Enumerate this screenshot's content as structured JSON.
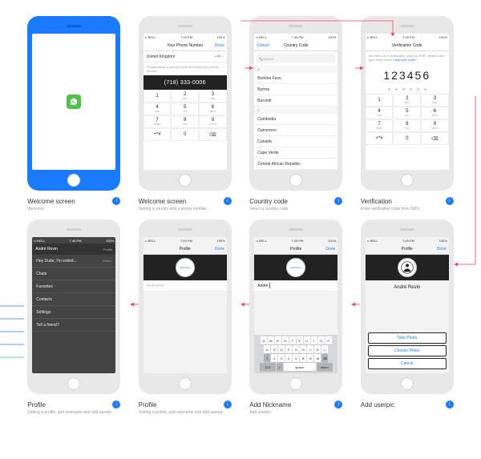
{
  "status": {
    "carrier": "•• BELL",
    "wifi": "⚲",
    "time": "7:45 PM",
    "batt": "100%"
  },
  "screens": [
    {
      "title": "Welcome screen",
      "sub": "Welcome"
    },
    {
      "title": "Welcome screen",
      "sub": "Setting a country and a phone number",
      "nav": {
        "title": "Your Phone Number",
        "right": "Done"
      },
      "country": "United Kingdom",
      "cc": "+44",
      "phone": "(718) 333-0006",
      "help": "Please select a country code and enter your phone number"
    },
    {
      "title": "Country code",
      "sub": "Select a country code",
      "nav": {
        "left": "Cancel",
        "title": "Country Code"
      },
      "search": "Search",
      "groups": [
        {
          "h": "B",
          "items": [
            "Burkina Faso",
            "Burma",
            "Burundi"
          ]
        },
        {
          "h": "C",
          "items": [
            "Cambodia",
            "Cameroon",
            "Canada",
            "Cape Verde",
            "Central African Republic"
          ]
        }
      ]
    },
    {
      "title": "Verification",
      "sub": "Enter verification code from SMS",
      "nav": {
        "title": "Verification Code"
      },
      "help": "We sent you a verification code by SMS, please enter your code below.",
      "helplink": "Help with code?",
      "code": "123456"
    },
    {
      "title": "Profile",
      "sub": "Setting a profile, add nickname and add userpic",
      "nav": {
        "name": "André Revin",
        "right": "Profile"
      },
      "status": {
        "text": "Hey Dude, I'm exited...",
        "sub": "Status"
      },
      "menu": [
        "Chats",
        "Favorites",
        "Contacts",
        "Settings",
        "Tell a friend?"
      ]
    },
    {
      "title": "Profile",
      "sub": "Setting a profile, add nickname and add userpic",
      "nav": {
        "title": "Profile",
        "right": "Done"
      },
      "avatar": "Add Photo",
      "nick_placeholder": "Nickname"
    },
    {
      "title": "Add Nickname",
      "sub": "Add userpic",
      "nav": {
        "title": "Profile",
        "right": "Done"
      },
      "avatar": "Add Photo",
      "nick_value": "Andre"
    },
    {
      "title": "Add userpic",
      "sub": "",
      "nav": {
        "title": "Profile",
        "right": "Done"
      },
      "name": "André Revin",
      "sheet": [
        "Take Photo",
        "Choose Photo",
        "Cancel"
      ]
    }
  ],
  "keypad": [
    [
      "1",
      ""
    ],
    [
      "2",
      "ABC"
    ],
    [
      "3",
      "DEF"
    ],
    [
      "4",
      "GHI"
    ],
    [
      "5",
      "JKL"
    ],
    [
      "6",
      "MNO"
    ],
    [
      "7",
      "PQRS"
    ],
    [
      "8",
      "TUV"
    ],
    [
      "9",
      "WXYZ"
    ],
    [
      "+*#",
      ""
    ],
    [
      "0",
      ""
    ],
    [
      "⌫",
      ""
    ]
  ],
  "qwerty": {
    "r1": [
      "Q",
      "W",
      "E",
      "R",
      "T",
      "Y",
      "U",
      "I",
      "O",
      "P"
    ],
    "r2": [
      "A",
      "S",
      "D",
      "F",
      "G",
      "H",
      "J",
      "K",
      "L"
    ],
    "r3": [
      "⇧",
      "Z",
      "X",
      "C",
      "V",
      "B",
      "N",
      "M",
      "⌫"
    ],
    "r4": [
      "123",
      "☺",
      "space",
      "return"
    ]
  }
}
